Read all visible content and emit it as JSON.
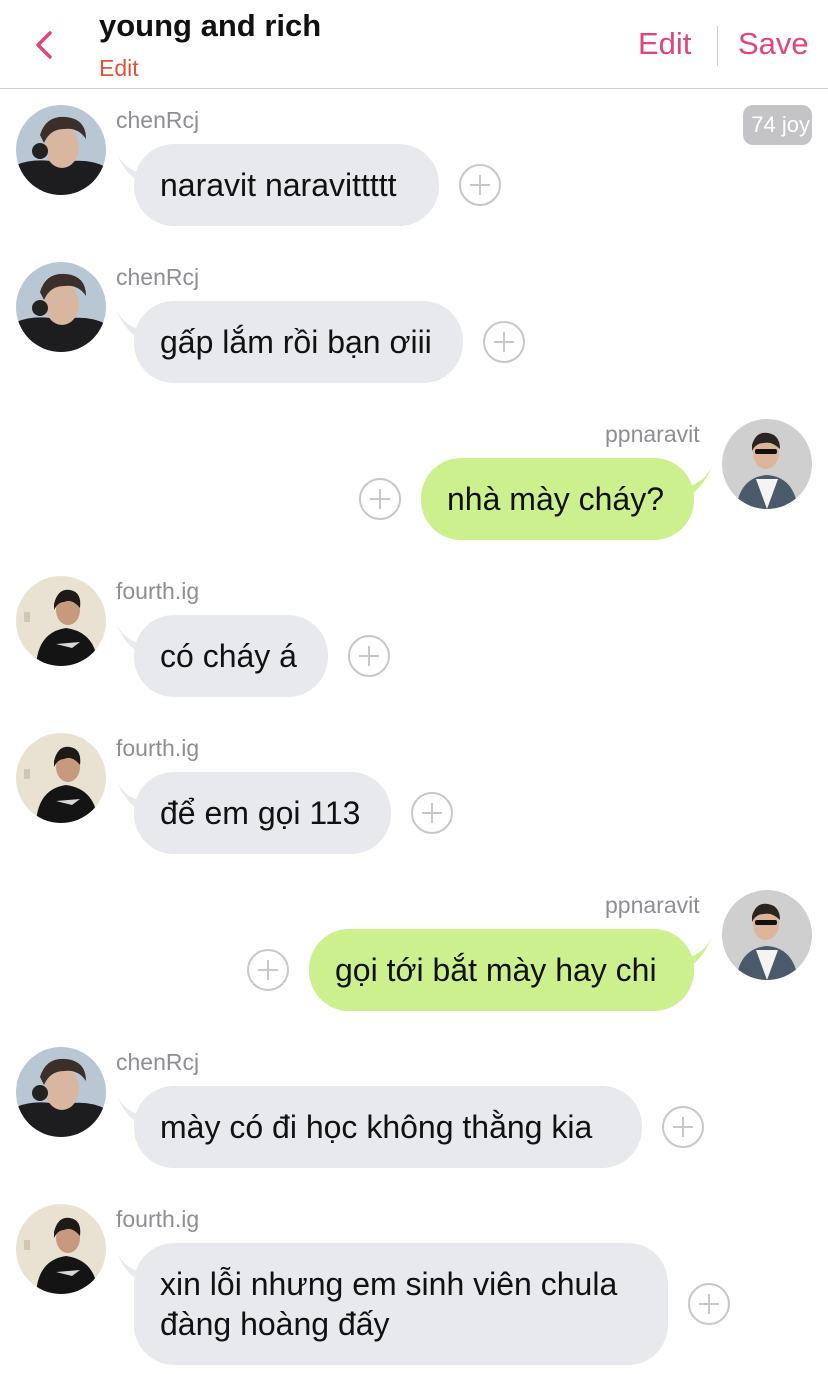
{
  "header": {
    "title": "young and rich",
    "subtitle": "Edit",
    "edit_label": "Edit",
    "save_label": "Save",
    "accent_color": "#e0457b",
    "subtitle_color": "#e0543a"
  },
  "badge": {
    "text": "74 joy"
  },
  "messages": [
    {
      "sender": "chenRcj",
      "text": "naravit naravittttt",
      "side": "left"
    },
    {
      "sender": "chenRcj",
      "text": "gấp lắm rồi bạn ơiii",
      "side": "left"
    },
    {
      "sender": "ppnaravit",
      "text": "nhà mày cháy?",
      "side": "right"
    },
    {
      "sender": "fourth.ig",
      "text": "có cháy á",
      "side": "left"
    },
    {
      "sender": "fourth.ig",
      "text": "để em gọi 113",
      "side": "left"
    },
    {
      "sender": "ppnaravit",
      "text": "gọi tới bắt mày hay chi",
      "side": "right"
    },
    {
      "sender": "chenRcj",
      "text": "mày có đi học không thằng kia",
      "side": "left"
    },
    {
      "sender": "fourth.ig",
      "text": "xin lỗi nhưng em sinh viên chula",
      "text2": "đàng hoàng đấy",
      "side": "left"
    }
  ],
  "colors": {
    "incoming_bubble": "#e7e9ec",
    "outgoing_bubble": "#ccf08e"
  },
  "icons": [
    "back-chevron-icon",
    "add-reaction-icon",
    "avatar-chenRcj",
    "avatar-ppnaravit",
    "avatar-fourth-ig"
  ]
}
